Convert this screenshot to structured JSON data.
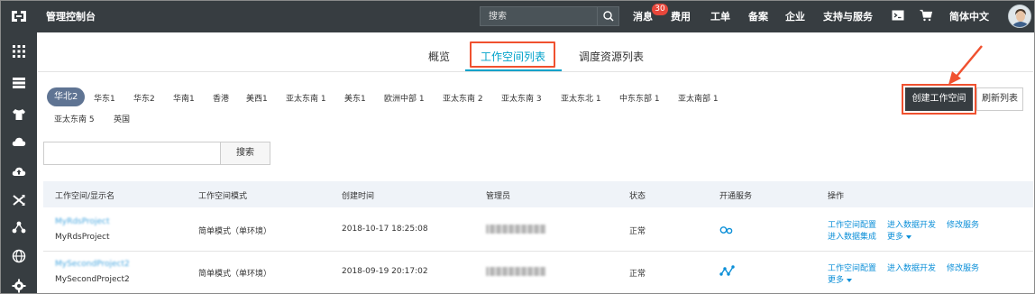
{
  "header": {
    "title": "管理控制台",
    "search_placeholder": "搜索",
    "nav": {
      "messages": "消息",
      "messages_badge": "30",
      "billing": "费用",
      "tickets": "工单",
      "icp": "备案",
      "enterprise": "企业",
      "support": "支持与服务",
      "language": "简体中文"
    },
    "icons": [
      "terminal-icon",
      "cart-icon",
      "avatar"
    ]
  },
  "sidebar": {
    "icons": [
      "apps-grid-icon",
      "server-list-icon",
      "shirt-icon",
      "cloud-icon",
      "cloud-upload-icon",
      "shuffle-icon",
      "network-icon",
      "globe-icon",
      "gear-icon"
    ]
  },
  "tabs": [
    {
      "label": "概览"
    },
    {
      "label": "工作空间列表"
    },
    {
      "label": "调度资源列表"
    }
  ],
  "regions": [
    "华北2",
    "华东1",
    "华东2",
    "华南1",
    "香港",
    "美西1",
    "亚太东南 1",
    "美东1",
    "欧洲中部 1",
    "亚太东南 2",
    "亚太东南 3",
    "亚太东北 1",
    "中东东部 1",
    "亚太南部 1",
    "亚太东南 5",
    "英国"
  ],
  "active_region": "华北2",
  "actions": {
    "create_label": "创建工作空间",
    "refresh_label": "刷新列表"
  },
  "filter": {
    "placeholder": "",
    "button_label": "搜索"
  },
  "table": {
    "columns": [
      "工作空间/显示名",
      "工作空间模式",
      "创建时间",
      "管理员",
      "状态",
      "开通服务",
      "操作"
    ],
    "rows": [
      {
        "name_blurred": "MyRdsProject",
        "display_name": "MyRdsProject",
        "mode": "简单模式（单环境）",
        "created": "2018-10-17 18:25:08",
        "status": "正常",
        "service_icon": "link-service-icon",
        "ops_line1": [
          "工作空间配置",
          "进入数据开发",
          "修改服务"
        ],
        "ops_line2": [
          "进入数据集成",
          "更多"
        ]
      },
      {
        "name_blurred": "MySecondProject2",
        "display_name": "MySecondProject2",
        "mode": "简单模式（单环境）",
        "created": "2018-09-19 20:17:02",
        "status": "正常",
        "service_icon": "node-graph-service-icon",
        "ops_line1": [
          "工作空间配置",
          "进入数据开发",
          "修改服务"
        ],
        "ops_line2": [
          "更多"
        ]
      }
    ]
  },
  "colors": {
    "topbar": "#373d41",
    "accent": "#00a2ca",
    "highlight": "#f0512f",
    "link": "#0b8fd8",
    "region_active": "#5f7493"
  }
}
